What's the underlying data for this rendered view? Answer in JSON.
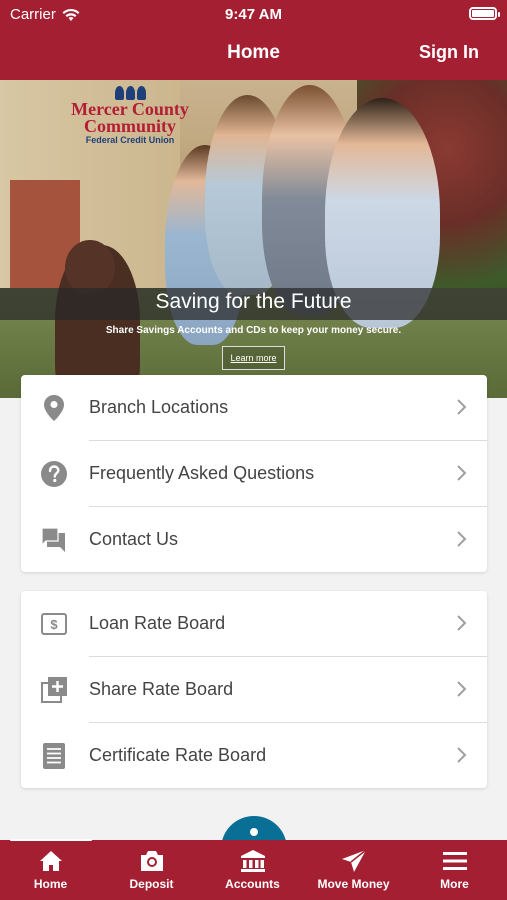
{
  "status_bar": {
    "carrier": "Carrier",
    "time": "9:47 AM"
  },
  "nav": {
    "title": "Home",
    "sign_in": "Sign In"
  },
  "hero": {
    "logo_line1": "Mercer County",
    "logo_line2": "Community",
    "logo_line3": "Federal Credit Union",
    "title": "Saving for the Future",
    "subtitle": "Share Savings Accounts and CDs to keep your money secure.",
    "button": "Learn more"
  },
  "menu_group1": [
    {
      "label": "Branch Locations",
      "icon": "map-pin-icon"
    },
    {
      "label": "Frequently Asked Questions",
      "icon": "question-icon"
    },
    {
      "label": "Contact Us",
      "icon": "chat-icon"
    }
  ],
  "menu_group2": [
    {
      "label": "Loan Rate Board",
      "icon": "dollar-icon"
    },
    {
      "label": "Share Rate Board",
      "icon": "add-box-icon"
    },
    {
      "label": "Certificate Rate Board",
      "icon": "document-icon"
    }
  ],
  "tabs": [
    {
      "label": "Home",
      "icon": "home-icon"
    },
    {
      "label": "Deposit",
      "icon": "camera-icon"
    },
    {
      "label": "Accounts",
      "icon": "bank-icon"
    },
    {
      "label": "Move Money",
      "icon": "send-icon"
    },
    {
      "label": "More",
      "icon": "menu-icon"
    }
  ],
  "colors": {
    "brand": "#a51f32",
    "fab": "#0a6f95",
    "icon_gray": "#8a8a8a"
  }
}
